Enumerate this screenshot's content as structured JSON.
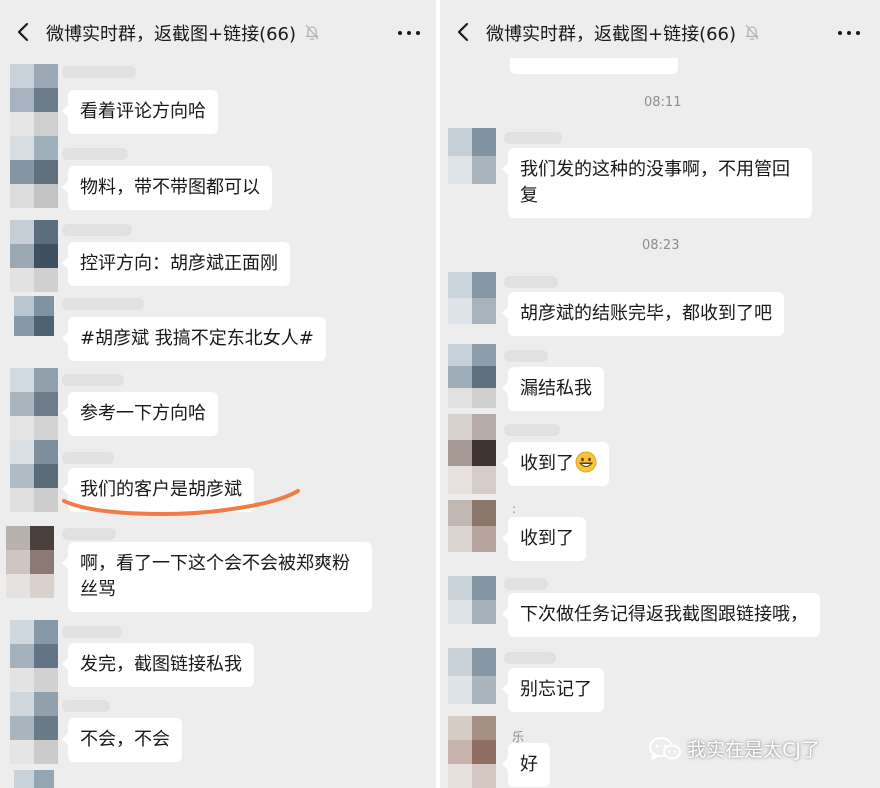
{
  "colors": {
    "background": "#ededed",
    "bubble": "#ffffff",
    "text": "#191919",
    "time_text": "#8e8e8e",
    "highlight_underline": "#ef7b45"
  },
  "chat_left": {
    "header": {
      "back_icon": "chevron-left-icon",
      "title": "微博实时群，返截图+链接(66)",
      "mute_icon": "bell-off-icon",
      "more_icon": "more-dots-icon"
    },
    "messages": [
      {
        "text": "看着评论方向哈"
      },
      {
        "text": "物料，带不带图都可以"
      },
      {
        "text": "控评方向：胡彦斌正面刚"
      },
      {
        "text": "#胡彦斌 我搞不定东北女人#"
      },
      {
        "text": "参考一下方向哈"
      },
      {
        "text": "我们的客户是胡彦斌",
        "highlighted": true
      },
      {
        "text": "啊，看了一下这个会不会被郑爽粉丝骂"
      },
      {
        "text": "发完，截图链接私我"
      },
      {
        "text": "不会，不会"
      }
    ]
  },
  "chat_right": {
    "header": {
      "back_icon": "chevron-left-icon",
      "title": "微博实时群，返截图+链接(66)",
      "mute_icon": "bell-off-icon",
      "more_icon": "more-dots-icon"
    },
    "timestamps": [
      "08:11",
      "08:23"
    ],
    "messages": [
      {
        "text": "我们发的这种的没事啊，不用管回复"
      },
      {
        "text": "胡彦斌的结账完毕，都收到了吧"
      },
      {
        "text": "漏结私我"
      },
      {
        "text": "收到了",
        "emoji": "grinning-face-emoji"
      },
      {
        "text": "收到了"
      },
      {
        "text": "下次做任务记得返我截图跟链接哦，"
      },
      {
        "text": "别忘记了"
      },
      {
        "text": "好"
      }
    ],
    "sender_names": [
      ":",
      "乐"
    ]
  },
  "watermark": {
    "icon": "wechat-logo-icon",
    "text": "我实在是太CJ了"
  }
}
